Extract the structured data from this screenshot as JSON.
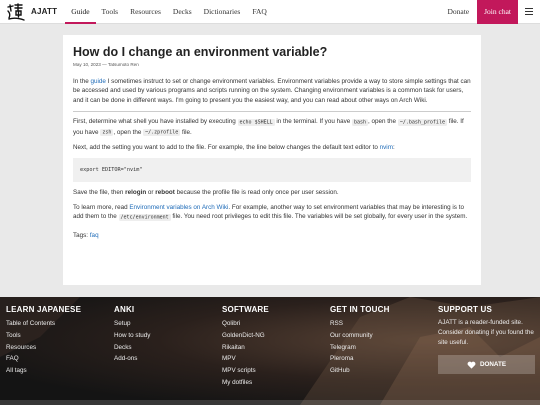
{
  "header": {
    "site_name": "AJATT",
    "nav": [
      {
        "label": "Guide",
        "active": true
      },
      {
        "label": "Tools",
        "active": false
      },
      {
        "label": "Resources",
        "active": false
      },
      {
        "label": "Decks",
        "active": false
      },
      {
        "label": "Dictionaries",
        "active": false
      },
      {
        "label": "FAQ",
        "active": false
      }
    ],
    "donate": "Donate",
    "join_chat": "Join chat"
  },
  "article": {
    "title": "How do I change an environment variable?",
    "meta": "May 10, 2023 — Tatsumoto Ren",
    "intro": {
      "pre": "In the ",
      "link": "guide",
      "post": " I sometimes instruct to set or change environment variables. Environment variables provide a way to store simple settings that can be accessed and used by various programs and scripts running on the system. Changing environment variables is a common task for users, and it can be done in different ways. I'm going to present you the easiest way, and you can read about other ways on Arch Wiki."
    },
    "p1": {
      "a": "First, determine what shell you have installed by executing ",
      "code1": "echo $SHELL",
      "b": " in the terminal. If you have ",
      "code2": "bash",
      "c": ", open the ",
      "code3": "~/.bash_profile",
      "d": " file. If you have ",
      "code4": "zsh",
      "e": ", open the ",
      "code5": "~/.zprofile",
      "f": " file."
    },
    "p2": {
      "a": "Next, add the setting you want to add to the file. For example, the line below changes the default text editor to ",
      "link": "nvim",
      "b": ":"
    },
    "codeblock": "export EDITOR=\"nvim\"",
    "p3": {
      "a": "Save the file, then ",
      "b1": "relogin",
      "b": " or ",
      "b2": "reboot",
      "c": " because the profile file is read only once per user session."
    },
    "p4": {
      "a": "To learn more, read ",
      "link": "Environment variables on Arch Wiki",
      "b": ". For example, another way to set environment variables that may be interesting is to add them to the ",
      "code": "/etc/environment",
      "c": " file. You need root privileges to edit this file. The variables will be set globally, for every user in the system."
    },
    "tags": {
      "label": "Tags: ",
      "tag": "faq"
    }
  },
  "footer": {
    "columns": [
      {
        "title": "LEARN JAPANESE",
        "links": [
          "Table of Contents",
          "Tools",
          "Resources",
          "FAQ",
          "All tags"
        ]
      },
      {
        "title": "ANKI",
        "links": [
          "Setup",
          "How to study",
          "Decks",
          "Add-ons"
        ]
      },
      {
        "title": "SOFTWARE",
        "links": [
          "Qolibri",
          "GoldenDict-NG",
          "Rikaitan",
          "MPV",
          "MPV scripts",
          "My dotfiles"
        ]
      },
      {
        "title": "GET IN TOUCH",
        "links": [
          "RSS",
          "Our community",
          "Telegram",
          "Pleroma",
          "GitHub"
        ]
      }
    ],
    "support": {
      "title": "SUPPORT US",
      "text": "AJATT is a reader-funded site. Consider donating if you found the site useful.",
      "button": "DONATE"
    }
  },
  "colors": {
    "accent": "#c2185b",
    "link": "#1e6bb8",
    "background": "#e9e9e9"
  },
  "icons": [
    "logo-kanji-icon",
    "menu-icon",
    "heart-icon"
  ]
}
